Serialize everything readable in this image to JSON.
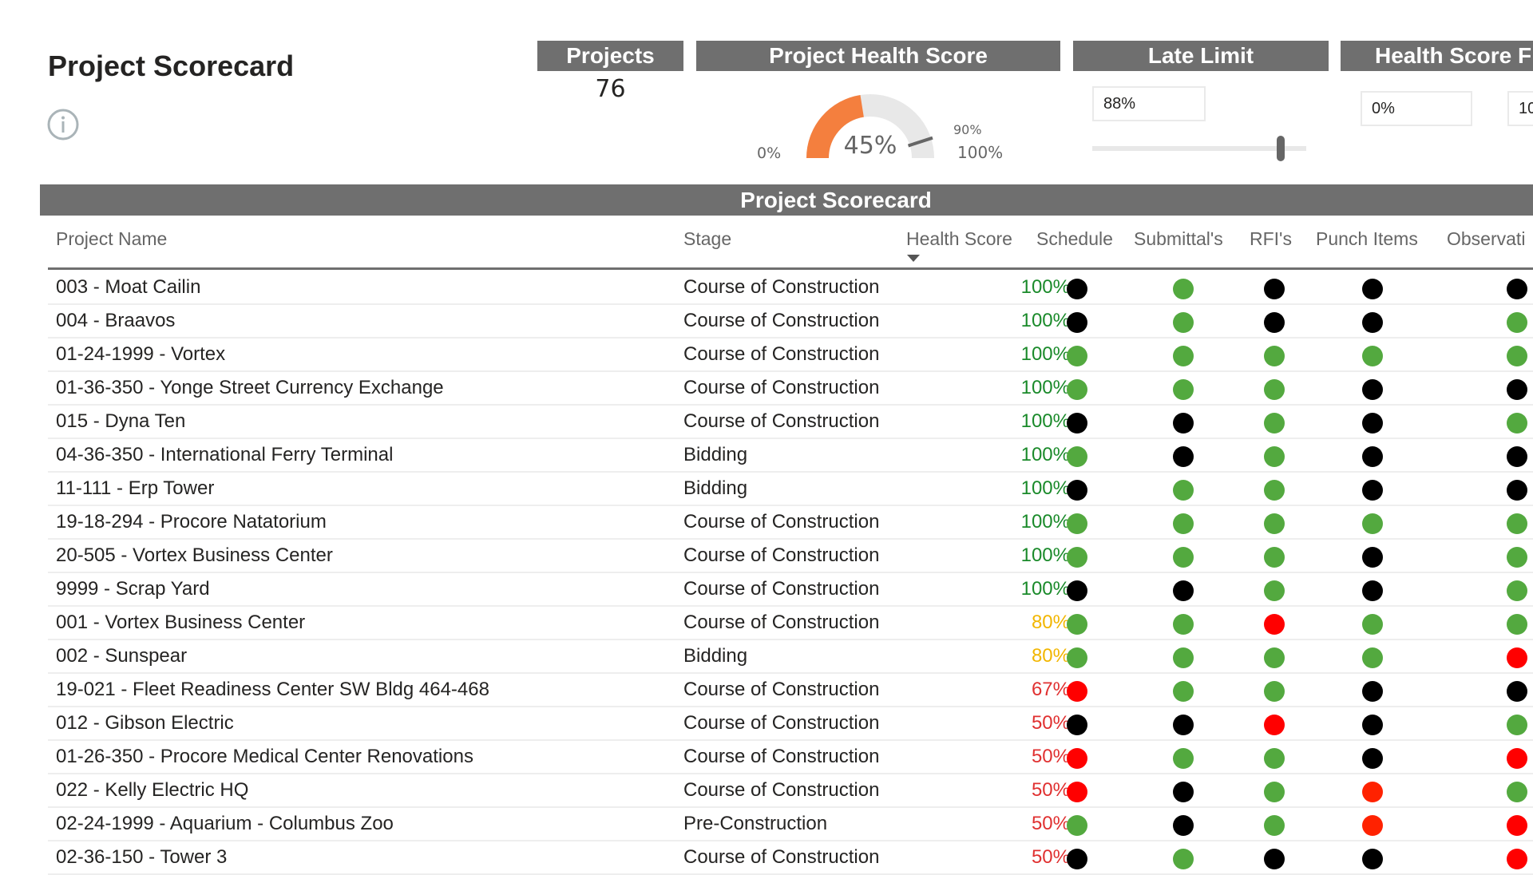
{
  "header": {
    "title": "Project Scorecard",
    "info_icon": "info-circle-icon"
  },
  "cards": {
    "projects": {
      "label": "Projects",
      "value": "76"
    },
    "health_score": {
      "label": "Project Health Score",
      "value_label": "45%",
      "value": 45,
      "min_label": "0%",
      "max_label": "100%",
      "target_label": "90%",
      "target": 90,
      "min": 0,
      "max": 100,
      "fill_color": "#f47f3e",
      "track_color": "#e8e8e8"
    },
    "late_limit": {
      "label": "Late Limit",
      "input_value": "88%",
      "slider_value": 88
    },
    "health_score_filter": {
      "label": "Health Score F",
      "min_value": "0%",
      "max_value": "10"
    }
  },
  "table": {
    "title": "Project Scorecard",
    "columns": [
      "Project Name",
      "Stage",
      "Health Score",
      "Schedule",
      "Submittal's",
      "RFI's",
      "Punch Items",
      "Observati"
    ],
    "sort_column": "Health Score",
    "sort_direction": "descending",
    "status_colors": {
      "green": "#53a93f",
      "black": "#000000",
      "red": "#ff0000",
      "orange_red": "#ff2200"
    },
    "score_colors": {
      "high": "#1a8a2a",
      "mid": "#f2b600",
      "low": "#e03030"
    },
    "rows": [
      {
        "name": "003 - Moat Cailin",
        "stage": "Course of Construction",
        "score": "100%",
        "level": "high",
        "status": [
          "black",
          "green",
          "black",
          "black",
          "black"
        ]
      },
      {
        "name": "004 - Braavos",
        "stage": "Course of Construction",
        "score": "100%",
        "level": "high",
        "status": [
          "black",
          "green",
          "black",
          "black",
          "green"
        ]
      },
      {
        "name": "01-24-1999 - Vortex",
        "stage": "Course of Construction",
        "score": "100%",
        "level": "high",
        "status": [
          "green",
          "green",
          "green",
          "green",
          "green"
        ]
      },
      {
        "name": "01-36-350 - Yonge Street Currency Exchange",
        "stage": "Course of Construction",
        "score": "100%",
        "level": "high",
        "status": [
          "green",
          "green",
          "green",
          "black",
          "black"
        ]
      },
      {
        "name": "015 - Dyna Ten",
        "stage": "Course of Construction",
        "score": "100%",
        "level": "high",
        "status": [
          "black",
          "black",
          "green",
          "black",
          "green"
        ]
      },
      {
        "name": "04-36-350 - International Ferry Terminal",
        "stage": "Bidding",
        "score": "100%",
        "level": "high",
        "status": [
          "green",
          "black",
          "green",
          "black",
          "black"
        ]
      },
      {
        "name": "11-111 - Erp Tower",
        "stage": "Bidding",
        "score": "100%",
        "level": "high",
        "status": [
          "black",
          "green",
          "green",
          "black",
          "black"
        ]
      },
      {
        "name": "19-18-294 - Procore Natatorium",
        "stage": "Course of Construction",
        "score": "100%",
        "level": "high",
        "status": [
          "green",
          "green",
          "green",
          "green",
          "green"
        ]
      },
      {
        "name": "20-505 - Vortex Business Center",
        "stage": "Course of Construction",
        "score": "100%",
        "level": "high",
        "status": [
          "green",
          "green",
          "green",
          "black",
          "green"
        ]
      },
      {
        "name": "9999 - Scrap Yard",
        "stage": "Course of Construction",
        "score": "100%",
        "level": "high",
        "status": [
          "black",
          "black",
          "green",
          "black",
          "green"
        ]
      },
      {
        "name": "001 - Vortex Business Center",
        "stage": "Course of Construction",
        "score": "80%",
        "level": "mid",
        "status": [
          "green",
          "green",
          "red",
          "green",
          "green"
        ]
      },
      {
        "name": "002 - Sunspear",
        "stage": "Bidding",
        "score": "80%",
        "level": "mid",
        "status": [
          "green",
          "green",
          "green",
          "green",
          "red"
        ]
      },
      {
        "name": "19-021 - Fleet Readiness Center SW Bldg 464-468",
        "stage": "Course of Construction",
        "score": "67%",
        "level": "low",
        "status": [
          "red",
          "green",
          "green",
          "black",
          "black"
        ]
      },
      {
        "name": "012 - Gibson Electric",
        "stage": "Course of Construction",
        "score": "50%",
        "level": "low",
        "status": [
          "black",
          "black",
          "red",
          "black",
          "green"
        ]
      },
      {
        "name": "01-26-350 - Procore Medical Center Renovations",
        "stage": "Course of Construction",
        "score": "50%",
        "level": "low",
        "status": [
          "red",
          "green",
          "green",
          "black",
          "red"
        ]
      },
      {
        "name": "022 - Kelly Electric HQ",
        "stage": "Course of Construction",
        "score": "50%",
        "level": "low",
        "status": [
          "red",
          "black",
          "green",
          "orange_red",
          "green"
        ]
      },
      {
        "name": "02-24-1999 - Aquarium - Columbus Zoo",
        "stage": "Pre-Construction",
        "score": "50%",
        "level": "low",
        "status": [
          "green",
          "black",
          "green",
          "orange_red",
          "red"
        ]
      },
      {
        "name": "02-36-150 - Tower 3",
        "stage": "Course of Construction",
        "score": "50%",
        "level": "low",
        "status": [
          "black",
          "green",
          "black",
          "black",
          "red"
        ]
      }
    ]
  }
}
